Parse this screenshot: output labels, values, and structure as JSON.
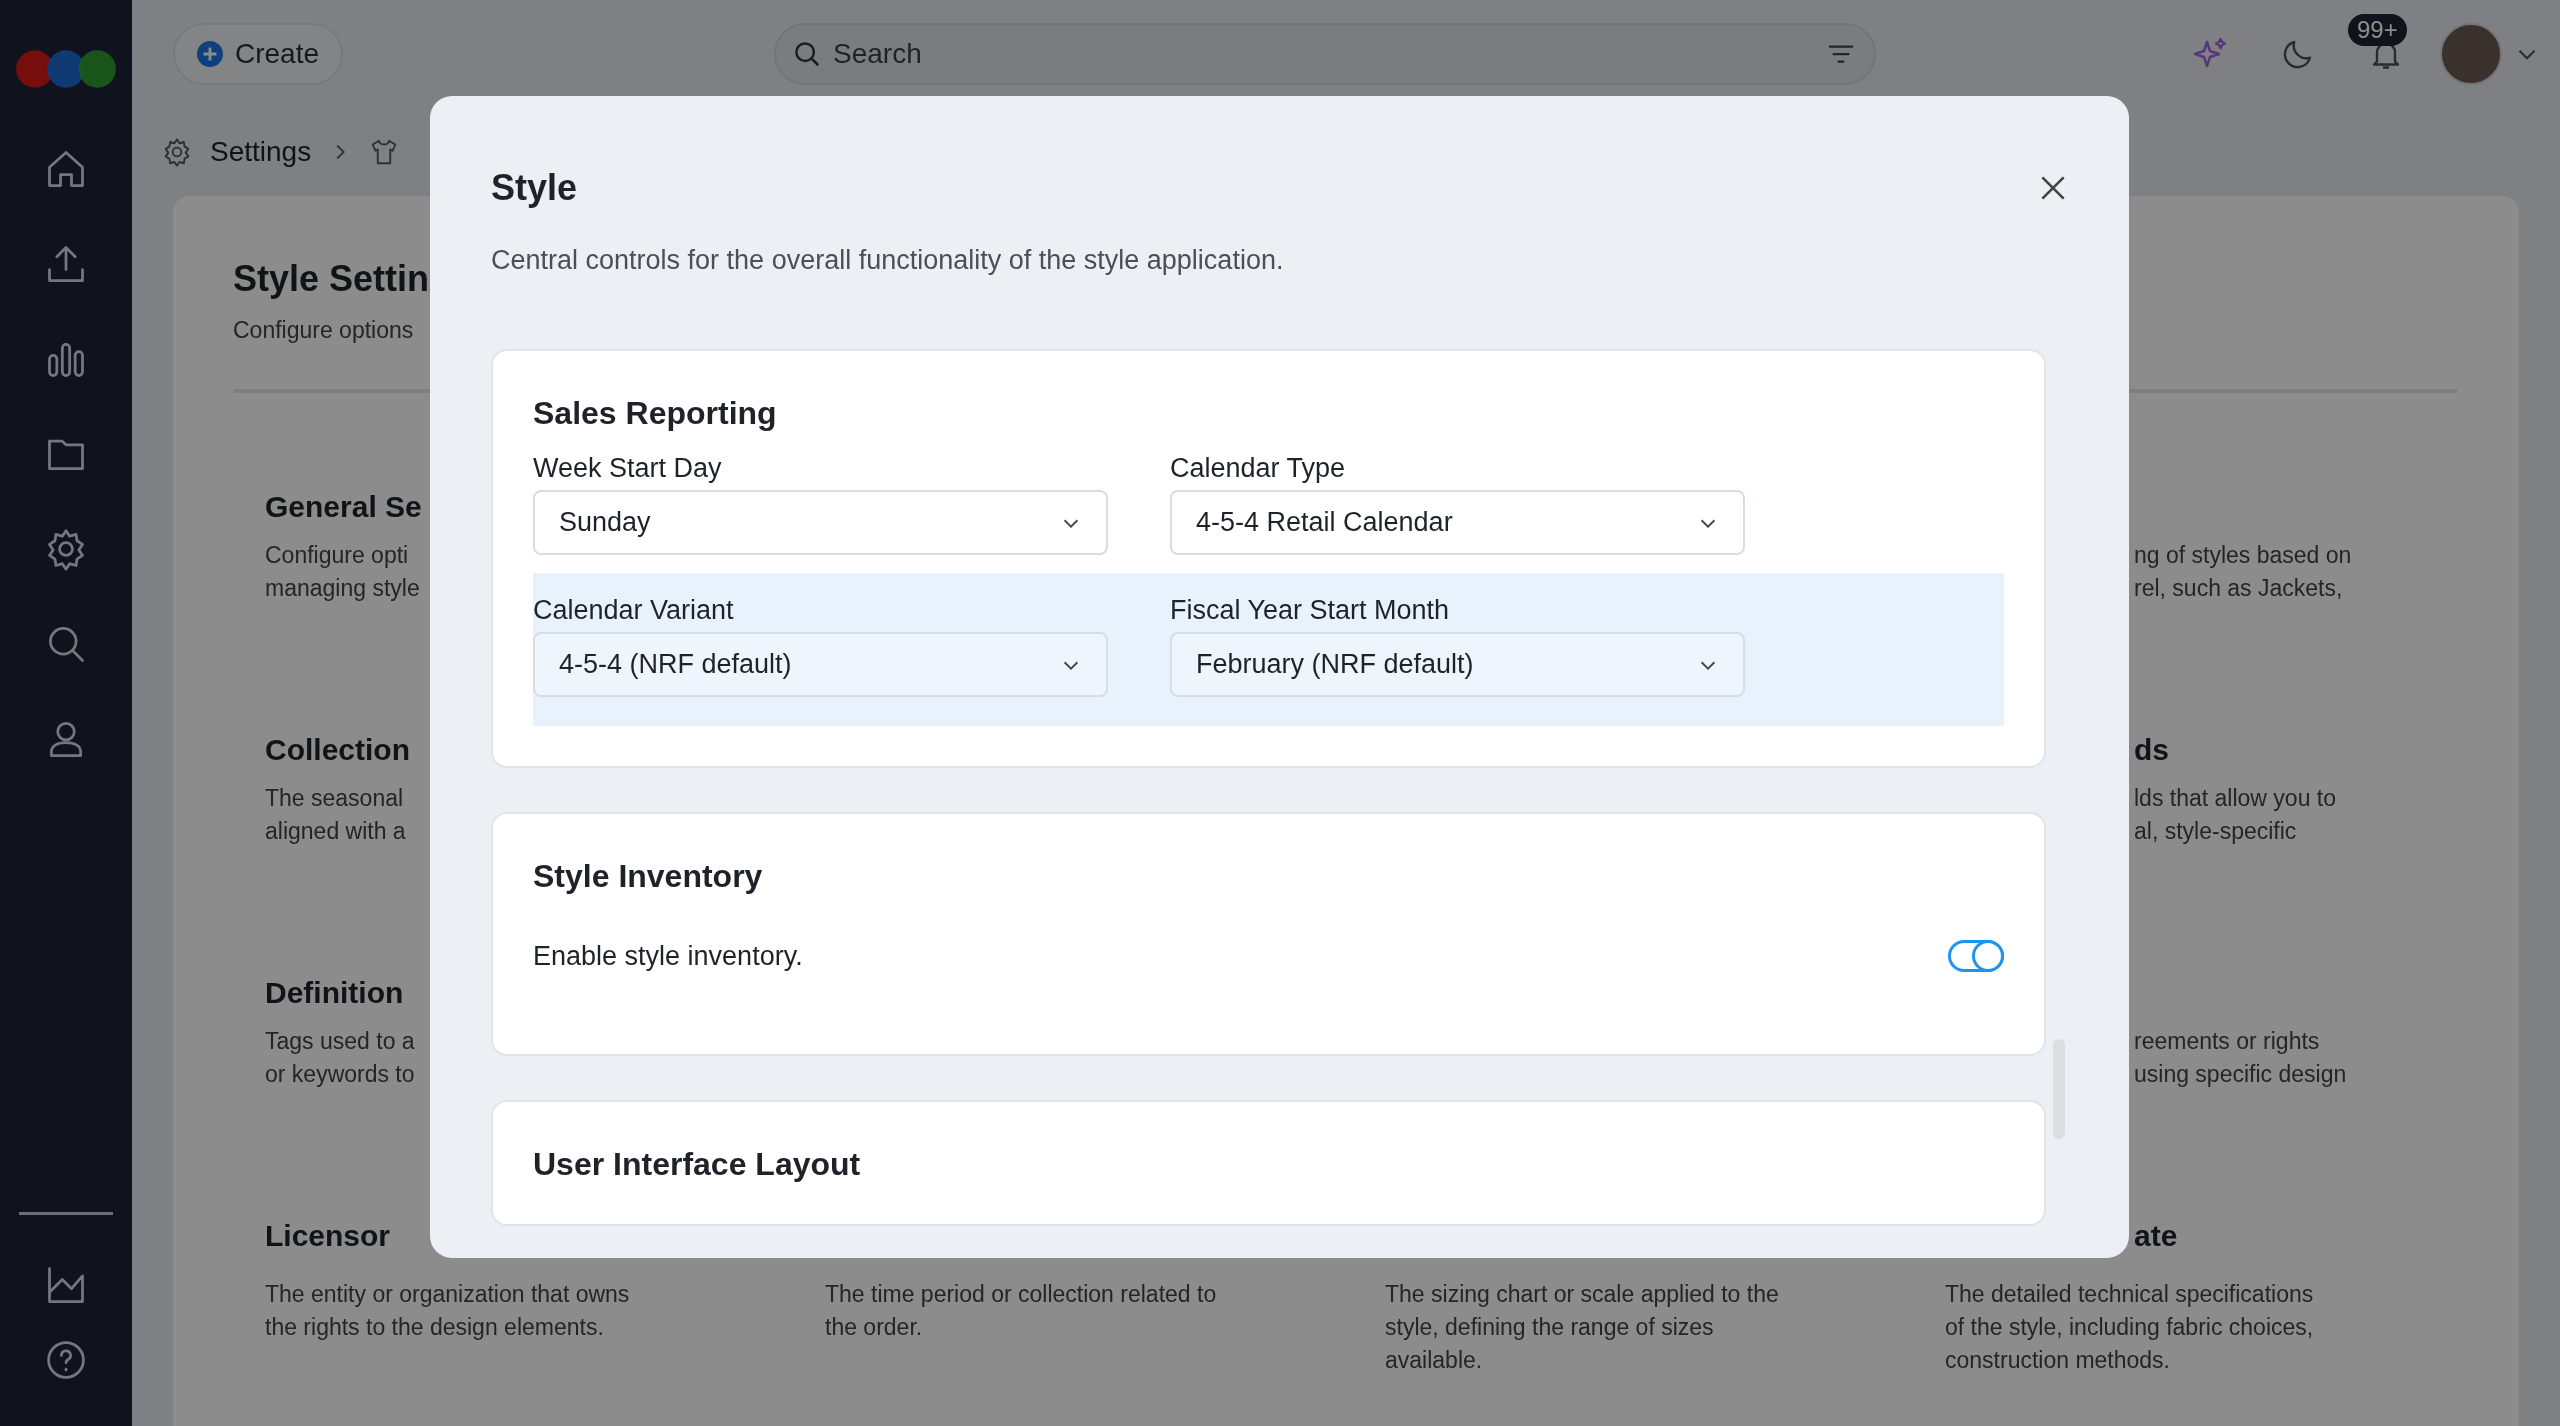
{
  "topbar": {
    "create_button": "Create",
    "search": {
      "placeholder": "Search"
    },
    "notifications_badge": "99+"
  },
  "breadcrumb": {
    "items": [
      "Settings"
    ]
  },
  "panel": {
    "title": "Style Settin",
    "subtitle": "Configure options",
    "rows": [
      {
        "cells": [
          {
            "heading": "General Se",
            "lines": [
              "Configure opti",
              "managing style"
            ]
          },
          {
            "lines": [
              "ng of styles based on",
              "rel, such as Jackets,"
            ]
          }
        ]
      },
      {
        "cells": [
          {
            "heading": "Collection",
            "lines": [
              "The seasonal",
              "aligned with a"
            ]
          },
          {
            "heading": "ds",
            "lines": [
              "lds that allow you to",
              "al, style-specific"
            ]
          }
        ]
      },
      {
        "cells": [
          {
            "heading": "Definition",
            "lines": [
              "Tags used to a",
              "or keywords to"
            ]
          },
          {
            "lines": [
              "reements or rights",
              "using specific design"
            ]
          }
        ]
      },
      {
        "cells": [
          {
            "heading": "Licensor",
            "lines": [
              "The entity or organization that owns",
              "the rights to the design elements."
            ]
          },
          {
            "lines": [
              "The time period or collection related to",
              "the order."
            ]
          },
          {
            "lines": [
              "The sizing chart or scale applied to the",
              "style, defining the range of sizes",
              "available."
            ]
          },
          {
            "heading": "ate",
            "lines": [
              "The detailed technical specifications",
              "of the style, including fabric choices,",
              "construction methods."
            ]
          }
        ]
      }
    ]
  },
  "modal": {
    "title": "Style",
    "description": "Central controls for the overall functionality of the style application.",
    "sections": [
      {
        "kind": "fields",
        "title": "Sales Reporting",
        "rows": [
          {
            "highlighted": false,
            "fields": [
              {
                "label": "Week Start Day",
                "value": "Sunday"
              },
              {
                "label": "Calendar Type",
                "value": "4-5-4 Retail Calendar"
              }
            ]
          },
          {
            "highlighted": true,
            "fields": [
              {
                "label": "Calendar Variant",
                "value": "4-5-4 (NRF default)"
              },
              {
                "label": "Fiscal Year Start Month",
                "value": "February (NRF default)"
              }
            ]
          }
        ]
      },
      {
        "kind": "toggles",
        "title": "Style Inventory",
        "toggles": [
          {
            "label": "Enable style inventory.",
            "on": true
          }
        ]
      },
      {
        "kind": "fields",
        "title": "User Interface Layout"
      }
    ]
  }
}
